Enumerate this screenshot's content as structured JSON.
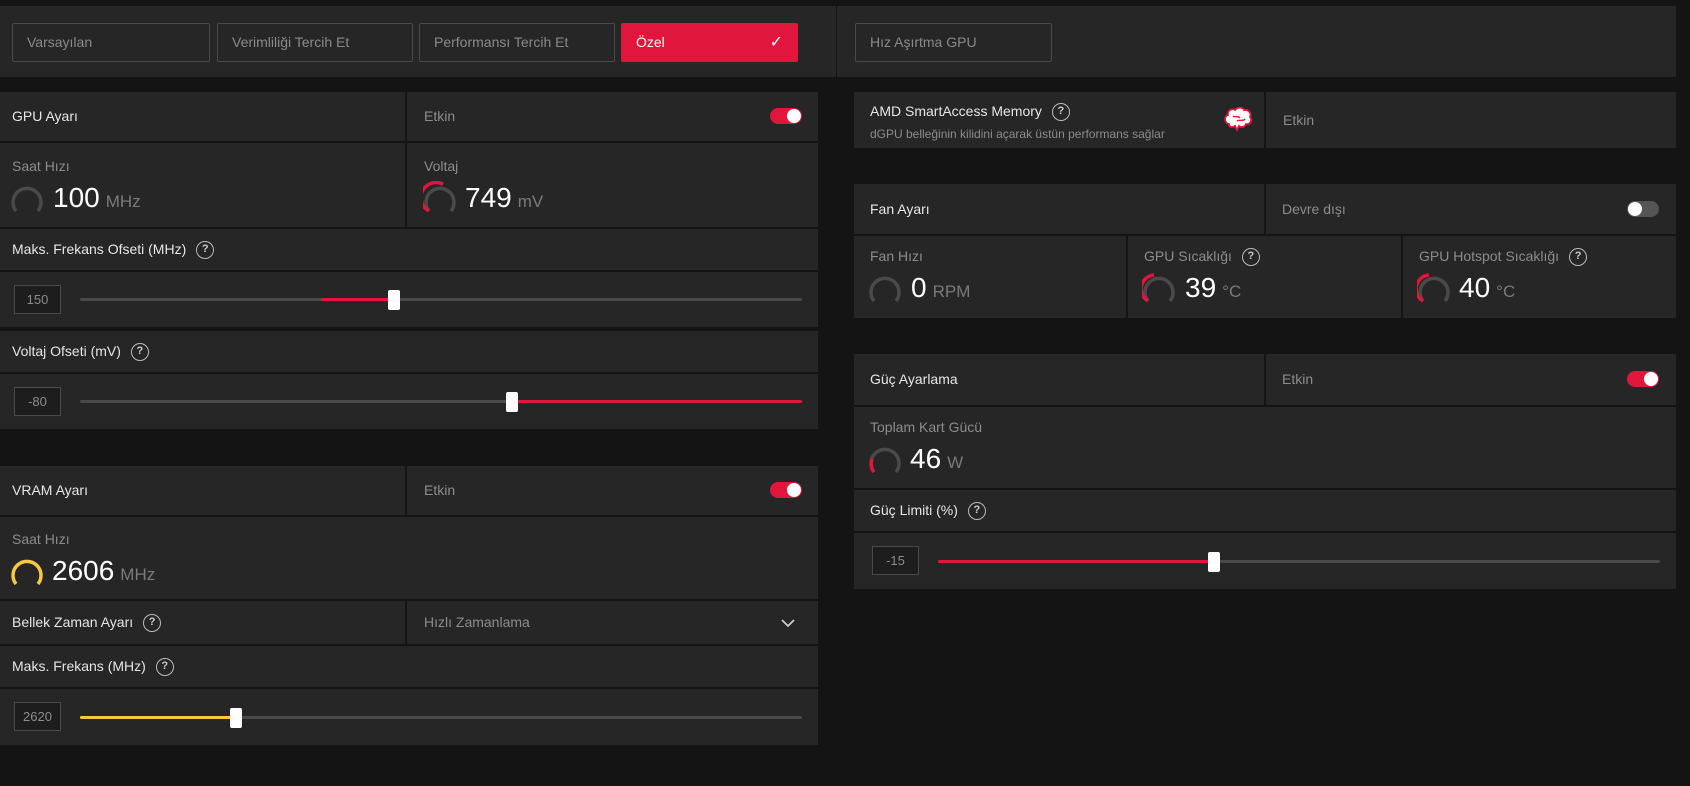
{
  "presets": {
    "default": "Varsayılan",
    "efficiency": "Verimliliği Tercih Et",
    "performance": "Performansı Tercih Et",
    "custom": "Özel",
    "overclock": "Hız Aşırtma GPU"
  },
  "gpu_tuning": {
    "title": "GPU Ayarı",
    "state": "Etkin",
    "enabled": true,
    "clock_label": "Saat Hızı",
    "clock_value": "100",
    "clock_unit": "MHz",
    "voltage_label": "Voltaj",
    "voltage_value": "749",
    "voltage_unit": "mV",
    "max_freq_offset_label": "Maks. Frekans Ofseti (MHz)",
    "max_freq_offset_value": "150",
    "voltage_offset_label": "Voltaj Ofseti (mV)",
    "voltage_offset_value": "-80"
  },
  "vram_tuning": {
    "title": "VRAM Ayarı",
    "state": "Etkin",
    "enabled": true,
    "clock_label": "Saat Hızı",
    "clock_value": "2606",
    "clock_unit": "MHz",
    "memory_timing_label": "Bellek Zaman Ayarı",
    "memory_timing_value": "Hızlı Zamanlama",
    "max_freq_label": "Maks. Frekans (MHz)",
    "max_freq_value": "2620"
  },
  "sam": {
    "title": "AMD SmartAccess Memory",
    "subtitle": "dGPU belleğinin kilidini açarak üstün performans sağlar",
    "state": "Etkin"
  },
  "fan_tuning": {
    "title": "Fan Ayarı",
    "state": "Devre dışı",
    "enabled": false,
    "fan_speed_label": "Fan Hızı",
    "fan_speed_value": "0",
    "fan_speed_unit": "RPM",
    "gpu_temp_label": "GPU Sıcaklığı",
    "gpu_temp_value": "39",
    "gpu_temp_unit": "°C",
    "hotspot_label": "GPU Hotspot Sıcaklığı",
    "hotspot_value": "40",
    "hotspot_unit": "°C"
  },
  "power_tuning": {
    "title": "Güç Ayarlama",
    "state": "Etkin",
    "enabled": true,
    "total_power_label": "Toplam Kart Gücü",
    "total_power_value": "46",
    "total_power_unit": "W",
    "power_limit_label": "Güç Limiti (%)",
    "power_limit_value": "-15"
  },
  "colors": {
    "accent": "#e0163c",
    "vram_accent": "#f5c842",
    "panel": "#262626",
    "background": "#141414"
  },
  "slider_levels": {
    "max_freq_offset": 0.43,
    "voltage_offset": 0.6,
    "vram_max_freq": 0.22,
    "power_limit": 0.38
  }
}
